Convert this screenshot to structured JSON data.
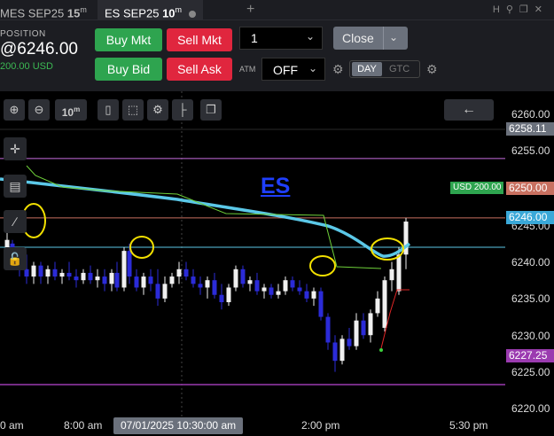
{
  "tabs": [
    {
      "label": "MES SEP25",
      "interval": "15",
      "interval_unit": "m"
    },
    {
      "label": "ES SEP25",
      "interval": "10",
      "interval_unit": "m"
    }
  ],
  "top_icons": [
    "H",
    "⚲",
    "❐",
    "✕"
  ],
  "position": {
    "label": "POSITION",
    "price": "@6246.00",
    "usd": "200.00 USD"
  },
  "order": {
    "buy_mkt": "Buy Mkt",
    "sell_mkt": "Sell Mkt",
    "buy_bid": "Buy Bid",
    "sell_ask": "Sell Ask",
    "quantity": "1",
    "close_label": "Close",
    "atm_label": "ATM",
    "atm_value": "OFF",
    "tif_day": "DAY",
    "tif_gtc": "GTC"
  },
  "toolbar": {
    "interval": "10",
    "interval_unit": "m"
  },
  "chart_label": "ES",
  "y_axis": {
    "ticks": [
      "6260.00",
      "6255.00",
      "6245.00",
      "6240.00",
      "6235.00",
      "6230.00",
      "6225.00",
      "6220.00"
    ],
    "tags": {
      "top": "6258.11",
      "target": "6250.00",
      "entry": "6246.00",
      "low": "6227.25"
    }
  },
  "usd_tag": "USD 200.00",
  "x_axis": {
    "ticks": [
      "0 am",
      "8:00 am",
      "2:00 pm",
      "5:30 pm"
    ],
    "crosshair": "07/01/2025 10:30:00 am"
  },
  "colors": {
    "buy": "#2ea44f",
    "sell": "#e0263e",
    "candle_up": "#f0f0f0",
    "candle_down": "#2b2bd8",
    "vwap": "#5bc8e8",
    "highlight": "#f2e000",
    "target_line": "#c87060",
    "entry_line": "#5bc8e8",
    "low_line": "#9b3bb0",
    "top_line": "#c86ee0"
  }
}
